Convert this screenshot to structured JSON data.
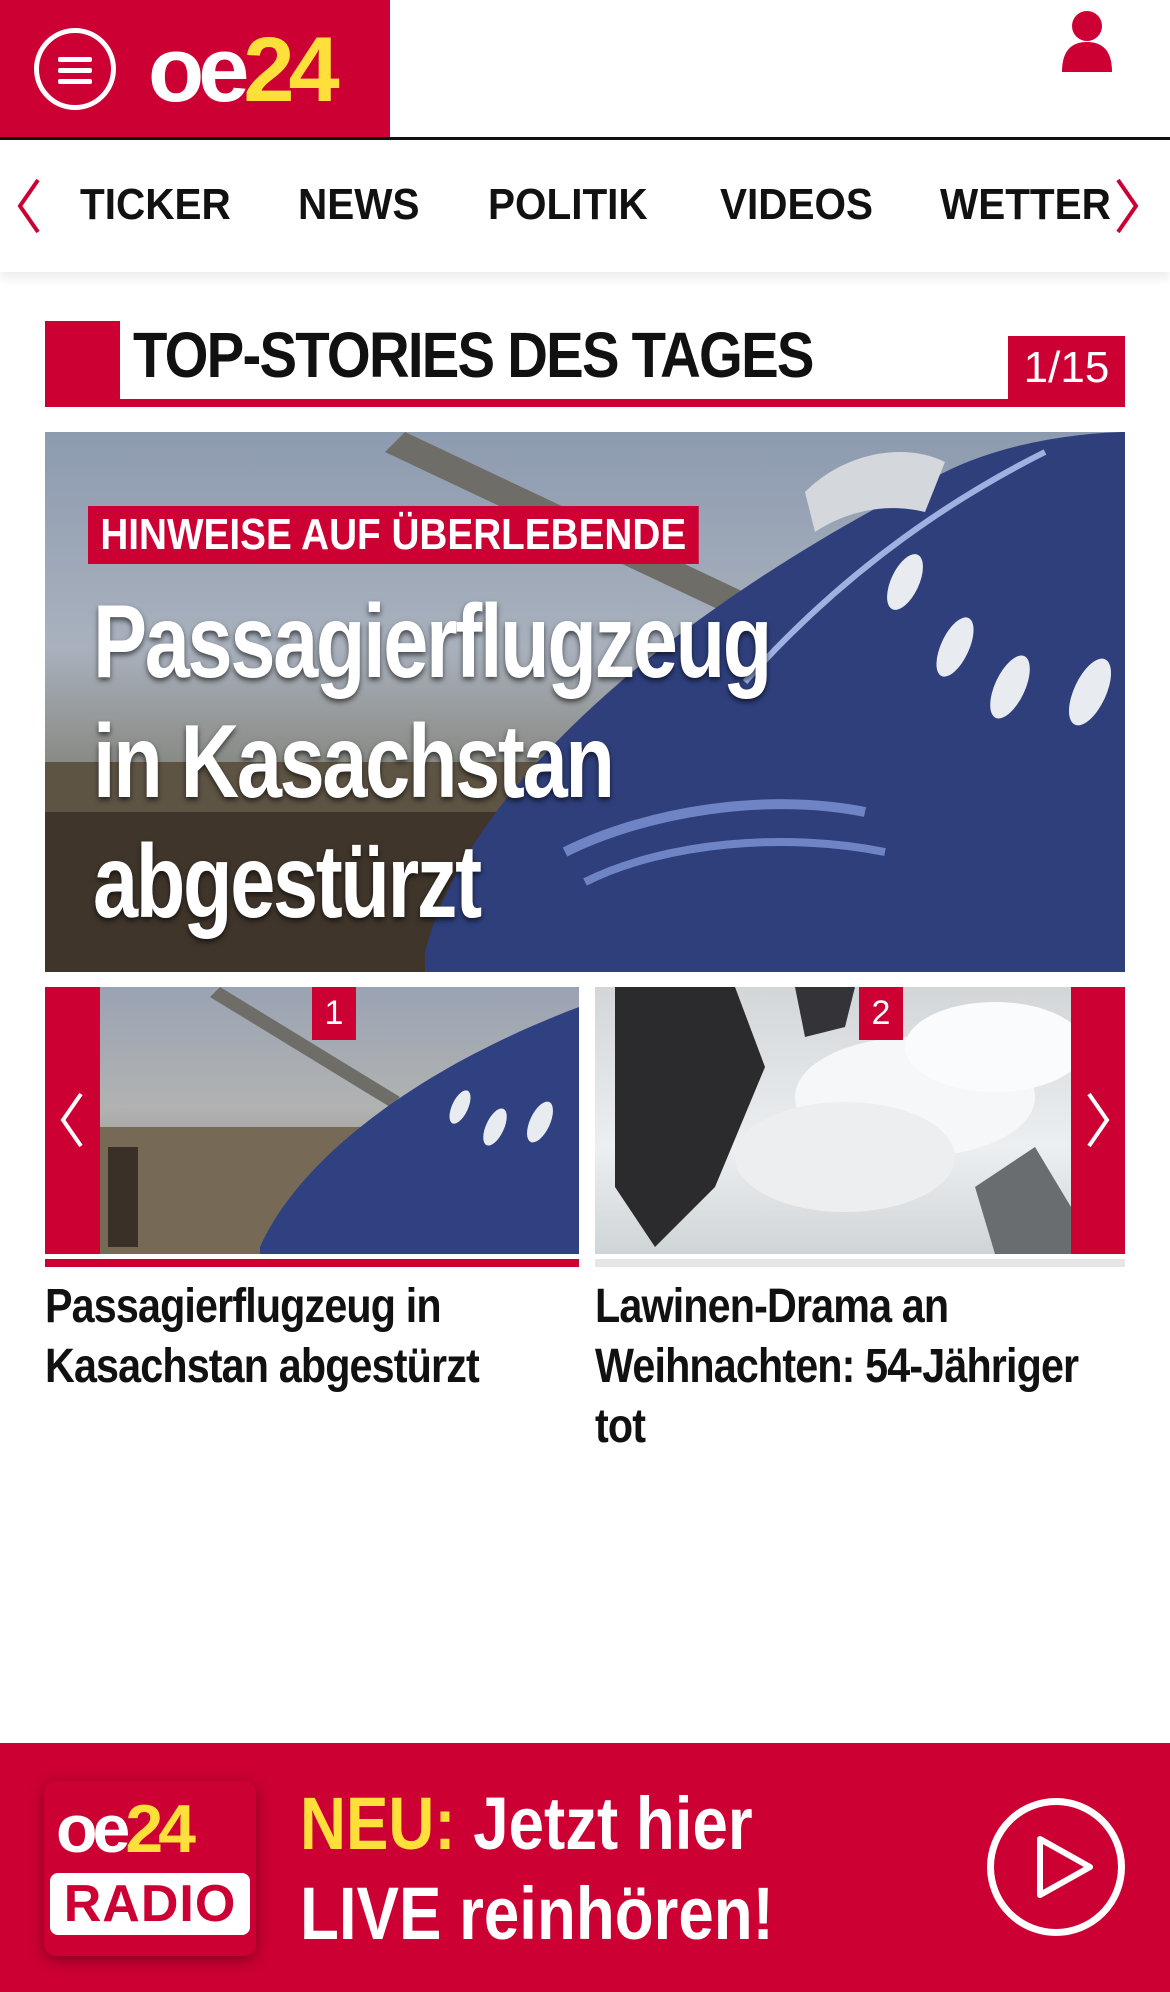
{
  "header": {
    "logo_oe": "oe",
    "logo_num": "24",
    "menu_icon": "hamburger-menu-icon",
    "user_icon": "user-icon"
  },
  "nav": {
    "items": [
      "TICKER",
      "NEWS",
      "POLITIK",
      "VIDEOS",
      "WETTER"
    ],
    "prev_icon": "chevron-left-icon",
    "next_icon": "chevron-right-icon"
  },
  "section": {
    "title": "TOP-STORIES DES TAGES",
    "counter": "1/15"
  },
  "hero": {
    "kicker": "HINWEISE AUF ÜBERLEBENDE",
    "title_lines": [
      "Passagierflugzeug",
      "in Kasachstan",
      "abgestürzt"
    ]
  },
  "carousel": {
    "cards": [
      {
        "badge": "1",
        "title": "Passagierflugzeug in Kasachstan abgestürzt"
      },
      {
        "badge": "2",
        "title": "Lawinen-Drama an Weihnachten: 54-Jähriger tot"
      }
    ]
  },
  "radio": {
    "logo_oe": "oe",
    "logo_num": "24",
    "logo_label": "RADIO",
    "highlight": "NEU:",
    "line1_rest": " Jetzt hier",
    "line2": "LIVE reinhören!",
    "play_icon": "play-icon"
  },
  "colors": {
    "brand_red": "#cc0033",
    "logo_yellow": "#ffe03a"
  }
}
